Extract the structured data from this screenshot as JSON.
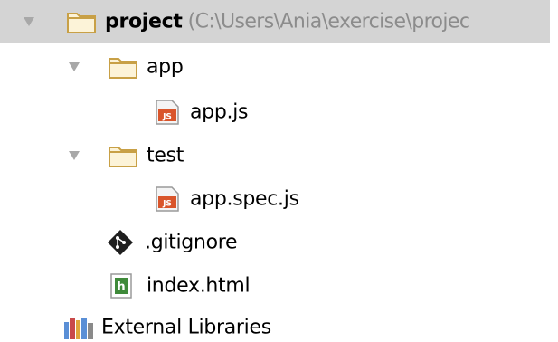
{
  "tree": {
    "root": {
      "name": "project",
      "path": "(C:\\Users\\Ania\\exercise\\projec"
    },
    "items": [
      {
        "name": "app",
        "type": "folder",
        "expanded": true
      },
      {
        "name": "app.js",
        "type": "js-file"
      },
      {
        "name": "test",
        "type": "folder",
        "expanded": true
      },
      {
        "name": "app.spec.js",
        "type": "js-file"
      },
      {
        "name": ".gitignore",
        "type": "git-file"
      },
      {
        "name": "index.html",
        "type": "html-file"
      }
    ],
    "external": {
      "name": "External Libraries"
    }
  },
  "icons": {
    "folder": "folder-icon",
    "js": "js-file-icon",
    "git": "gitignore-icon",
    "html": "html-file-icon",
    "libraries": "libraries-icon",
    "expand": "chevron-down-icon"
  },
  "colors": {
    "selection": "#d4d4d4",
    "folder_fill": "#fcf3d8",
    "folder_stroke": "#c8a046",
    "js_badge": "#d9552b",
    "path_text": "#8c8c8c",
    "html_icon": "#3f8a3a"
  }
}
